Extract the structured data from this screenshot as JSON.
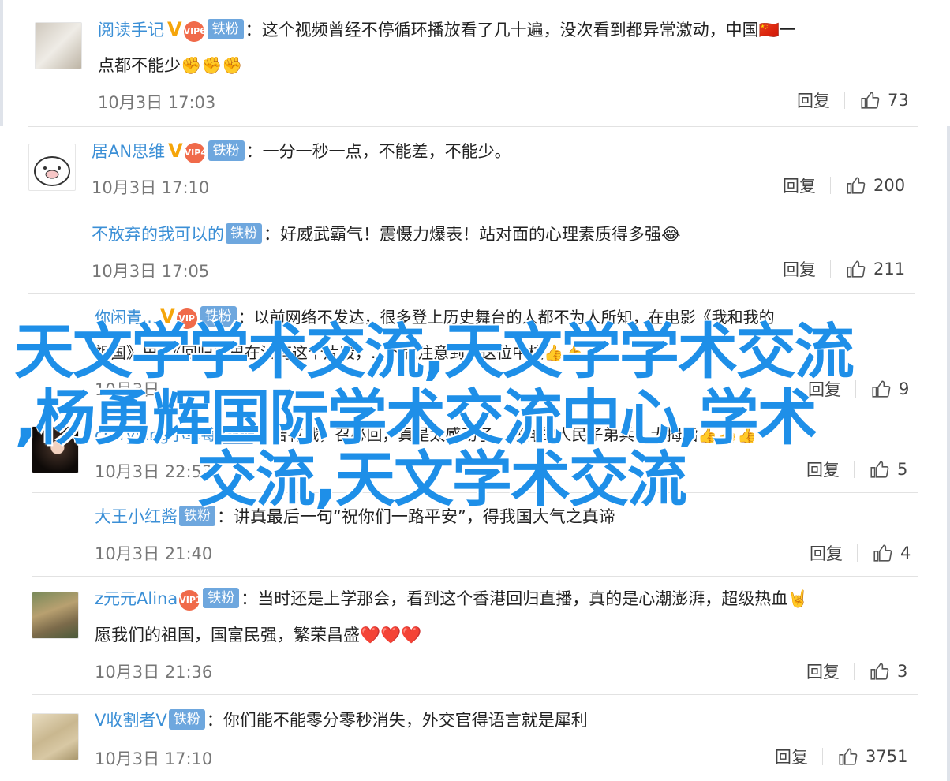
{
  "comments": [
    {
      "user": "阅读手记",
      "badges": {
        "v": "V",
        "vip": "VIP6",
        "fan": "铁粉"
      },
      "text_line1": "：这个视频曾经不停循环播放看了几十遍，没次看到都异常激动，中国🇨🇳一",
      "text_line2": "点都不能少✊✊✊",
      "time": "10月3日 17:03",
      "reply": "回复",
      "likes": "73"
    },
    {
      "user": "居AN思维",
      "badges": {
        "v": "V",
        "vip": "VIP4",
        "fan": "铁粉"
      },
      "text_line1": "：一分一秒一点，不能差，不能少。",
      "time": "10月3日 17:10",
      "reply": "回复",
      "likes": "200"
    },
    {
      "user": "不放弃的我可以的",
      "badges": {
        "fan": "铁粉"
      },
      "text_line1": "：好威武霸气！震慑力爆表！站对面的心理素质得多强😂",
      "time": "10月3日 17:05",
      "reply": "回复",
      "likes": "211"
    },
    {
      "user": "你闲青...",
      "badges": {
        "v": "V",
        "vip": "VIP",
        "fan": "铁粉"
      },
      "text_line1": "：以前网络不发达，很多登上历史舞台的人都不为人所知，在电影《我和我的",
      "text_line2": "祖国》里，《回归》里在没有这个片段，...下就注意到了这位中校👍👍👍",
      "time": "10月3日 ...",
      "reply": "回复",
      "likes": "9"
    },
    {
      "user": "chrryying小草莓",
      "badges": {
        "fan": "铁粉"
      },
      "text_line1": "：若有战，召必回，真是太感动了，好样的人民子弟兵！大拇指👍👍👍",
      "time": "10月3日 22:53",
      "reply": "回复",
      "likes": "5"
    },
    {
      "user": "大王小红酱",
      "badges": {
        "fan": "铁粉"
      },
      "text_line1": "：讲真最后一句“祝你们一路平安”，得我国大气之真谛",
      "time": "10月3日 21:40",
      "reply": "回复",
      "likes": "4"
    },
    {
      "user": "z元元Alina",
      "badges": {
        "vip": "VIP1",
        "fan": "铁粉"
      },
      "text_line1": "：当时还是上学那会，看到这个香港回归直播，真的是心潮澎湃，超级热血🤘",
      "text_line2": "愿我们的祖国，国富民强，繁荣昌盛❤️❤️❤️",
      "time": "10月3日 21:36",
      "reply": "回复",
      "likes": "3"
    },
    {
      "user": "V收割者V",
      "badges": {
        "fan": "铁粉"
      },
      "text_line1": "：你们能不能零分零秒消失，外交官得语言就是犀利",
      "time": "10月3日 17:10",
      "reply": "回复",
      "likes": "3751"
    }
  ],
  "overlay": {
    "line1": "天文学学术交流,天文学学术交流",
    "line2": ",杨勇辉国际学术交流中心,学术",
    "line3": "交流,天文学术交流"
  },
  "colors": {
    "username": "#3b8fd6",
    "badge": "#6ea7de",
    "overlay": "#1e8fe8"
  },
  "icons": [
    "thumb-up-icon",
    "avatar-image"
  ]
}
